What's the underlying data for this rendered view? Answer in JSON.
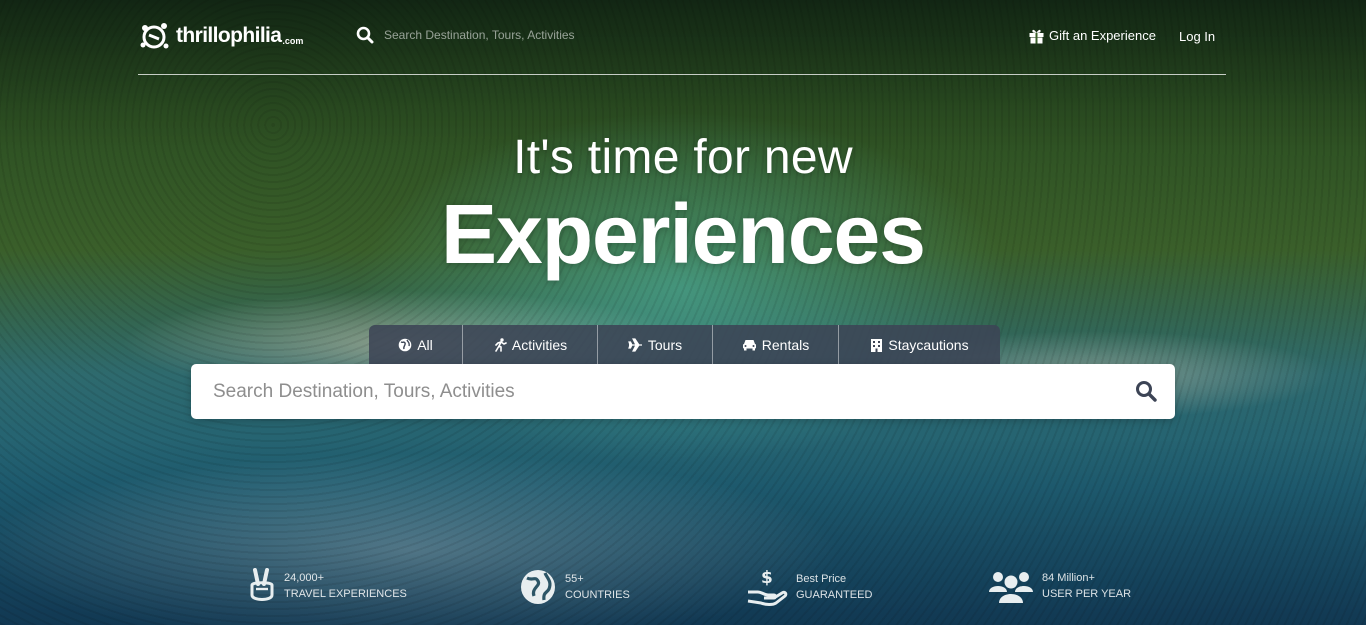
{
  "brand": {
    "name": "thrillophilia",
    "suffix": ".com"
  },
  "header": {
    "search_placeholder": "Search Destination, Tours, Activities",
    "gift_label": "Gift an Experience",
    "login_label": "Log In"
  },
  "hero": {
    "subtitle": "It's time for new",
    "title": "Experiences"
  },
  "tabs": [
    {
      "label": "All",
      "icon": "globe-icon"
    },
    {
      "label": "Activities",
      "icon": "activity-icon"
    },
    {
      "label": "Tours",
      "icon": "plane-icon"
    },
    {
      "label": "Rentals",
      "icon": "car-icon"
    },
    {
      "label": "Staycautions",
      "icon": "building-icon"
    }
  ],
  "search": {
    "placeholder": "Search Destination, Tours, Activities"
  },
  "stats": [
    {
      "value": "24,000+",
      "caption": "Travel Experiences",
      "icon": "peace-hand-icon"
    },
    {
      "value": "55+",
      "caption": "Countries",
      "icon": "globe-icon"
    },
    {
      "value": "Best Price",
      "caption": "Guaranteed",
      "icon": "dollar-hand-icon"
    },
    {
      "value": "84 Million+",
      "caption": "User per year",
      "icon": "users-icon"
    }
  ],
  "colors": {
    "tab_bar": "#3c4455",
    "search_bg": "#ffffff",
    "search_icon": "#3c4455"
  }
}
